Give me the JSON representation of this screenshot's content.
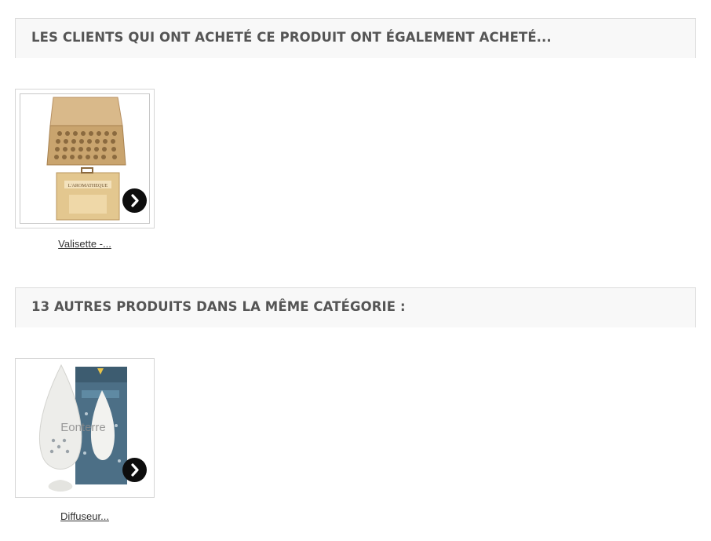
{
  "sections": [
    {
      "heading": "LES CLIENTS QUI ONT ACHETÉ CE PRODUIT ONT ÉGALEMENT ACHETÉ...",
      "products": [
        {
          "name": "Valisette -...",
          "image_icon": "wooden-case-image",
          "box_label": "L'AROMATHEQUE"
        }
      ]
    },
    {
      "heading": "13 AUTRES PRODUITS DANS LA MÊME CATÉGORIE :",
      "products": [
        {
          "name": "Diffuseur...",
          "image_icon": "ceramic-diffuser-image",
          "watermark": "Eonterre"
        }
      ]
    }
  ],
  "colors": {
    "header_bg": "#f8f8f8",
    "header_border": "#dcdcdc",
    "heading_text": "#555555",
    "arrow_button": "#0d0d0d",
    "link_text": "#333333"
  }
}
